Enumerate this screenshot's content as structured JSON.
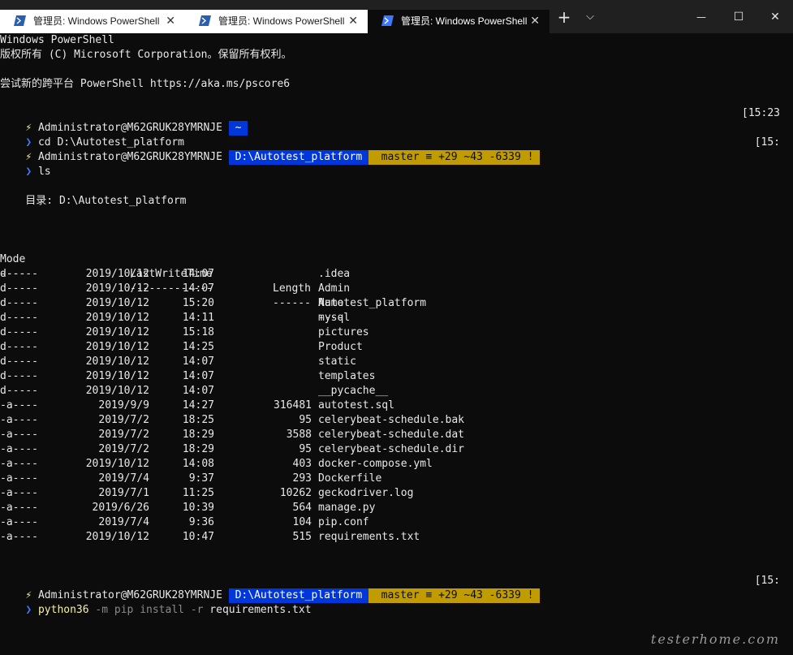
{
  "tabs": [
    {
      "title": "管理员: Windows PowerShell",
      "close": "✕",
      "state": "inactive"
    },
    {
      "title": "管理员: Windows PowerShell",
      "close": "✕",
      "state": "inactive"
    },
    {
      "title": "管理员: Windows PowerShell",
      "close": "✕",
      "state": "active"
    }
  ],
  "tabbar": {
    "new_tab": "+",
    "dropdown": "⌵",
    "minimize": "—",
    "maximize": "☐",
    "close": "✕"
  },
  "banner": {
    "line1": "Windows PowerShell",
    "line2": "版权所有 (C) Microsoft Corporation。保留所有权利。",
    "line3": "尝试新的跨平台 PowerShell https://aka.ms/pscore6"
  },
  "prompt1": {
    "bolt": "⚡",
    "user": " Administrator@M62GRUK28YMRNJE ",
    "sep_a": "",
    "path": " ~ ",
    "sep_b": "",
    "time": "[15:23"
  },
  "cmd1": {
    "arrow": "❯",
    "text": " cd D:\\Autotest_platform"
  },
  "prompt2": {
    "bolt": "⚡",
    "user": " Administrator@M62GRUK28YMRNJE ",
    "sep_a": "",
    "path": " D:\\Autotest_platform ",
    "sep_b": "",
    "branch_icon": " ",
    "git": " master ≡ +29 ~43 -6339 ! ",
    "sep_c": "",
    "time": "[15:"
  },
  "cmd2": {
    "arrow": "❯",
    "text": " ls"
  },
  "dir_header": "    目录: D:\\Autotest_platform",
  "table": {
    "headers": {
      "mode": "Mode",
      "time": "LastWriteTime",
      "length": "Length",
      "name": "Name"
    },
    "underline": {
      "mode": "----",
      "time": "-------------",
      "length": "------",
      "name": "----"
    },
    "rows": [
      {
        "mode": "d-----",
        "date": "2019/10/12",
        "time": "14:07",
        "length": "",
        "name": ".idea"
      },
      {
        "mode": "d-----",
        "date": "2019/10/12",
        "time": "14:07",
        "length": "",
        "name": "Admin"
      },
      {
        "mode": "d-----",
        "date": "2019/10/12",
        "time": "15:20",
        "length": "",
        "name": "Autotest_platform"
      },
      {
        "mode": "d-----",
        "date": "2019/10/12",
        "time": "14:11",
        "length": "",
        "name": "mysql"
      },
      {
        "mode": "d-----",
        "date": "2019/10/12",
        "time": "15:18",
        "length": "",
        "name": "pictures"
      },
      {
        "mode": "d-----",
        "date": "2019/10/12",
        "time": "14:25",
        "length": "",
        "name": "Product"
      },
      {
        "mode": "d-----",
        "date": "2019/10/12",
        "time": "14:07",
        "length": "",
        "name": "static"
      },
      {
        "mode": "d-----",
        "date": "2019/10/12",
        "time": "14:07",
        "length": "",
        "name": "templates"
      },
      {
        "mode": "d-----",
        "date": "2019/10/12",
        "time": "14:07",
        "length": "",
        "name": "__pycache__"
      },
      {
        "mode": "-a----",
        "date": "2019/9/9",
        "time": "14:27",
        "length": "316481",
        "name": "autotest.sql"
      },
      {
        "mode": "-a----",
        "date": "2019/7/2",
        "time": "18:25",
        "length": "95",
        "name": "celerybeat-schedule.bak"
      },
      {
        "mode": "-a----",
        "date": "2019/7/2",
        "time": "18:29",
        "length": "3588",
        "name": "celerybeat-schedule.dat"
      },
      {
        "mode": "-a----",
        "date": "2019/7/2",
        "time": "18:29",
        "length": "95",
        "name": "celerybeat-schedule.dir"
      },
      {
        "mode": "-a----",
        "date": "2019/10/12",
        "time": "14:08",
        "length": "403",
        "name": "docker-compose.yml"
      },
      {
        "mode": "-a----",
        "date": "2019/7/4",
        "time": "9:37",
        "length": "293",
        "name": "Dockerfile"
      },
      {
        "mode": "-a----",
        "date": "2019/7/1",
        "time": "11:25",
        "length": "10262",
        "name": "geckodriver.log"
      },
      {
        "mode": "-a----",
        "date": "2019/6/26",
        "time": "10:39",
        "length": "564",
        "name": "manage.py"
      },
      {
        "mode": "-a----",
        "date": "2019/7/4",
        "time": "9:36",
        "length": "104",
        "name": "pip.conf"
      },
      {
        "mode": "-a----",
        "date": "2019/10/12",
        "time": "10:47",
        "length": "515",
        "name": "requirements.txt"
      }
    ]
  },
  "prompt3": {
    "bolt": "⚡",
    "user": " Administrator@M62GRUK28YMRNJE ",
    "sep_a": "",
    "path": " D:\\Autotest_platform ",
    "sep_b": "",
    "branch_icon": " ",
    "git": " master ≡ +29 ~43 -6339 ! ",
    "sep_c": "",
    "time": "[15:"
  },
  "cmd3": {
    "arrow": "❯",
    "exe": " python36",
    "args": " -m pip install -r",
    "file": " requirements.txt"
  },
  "watermark": "testerhome.com",
  "colors": {
    "terminal_bg": "#0c0c0c",
    "tabbar_bg": "#202020",
    "path_bg": "#0037da",
    "git_bg": "#c19c00",
    "text": "#cccccc"
  }
}
